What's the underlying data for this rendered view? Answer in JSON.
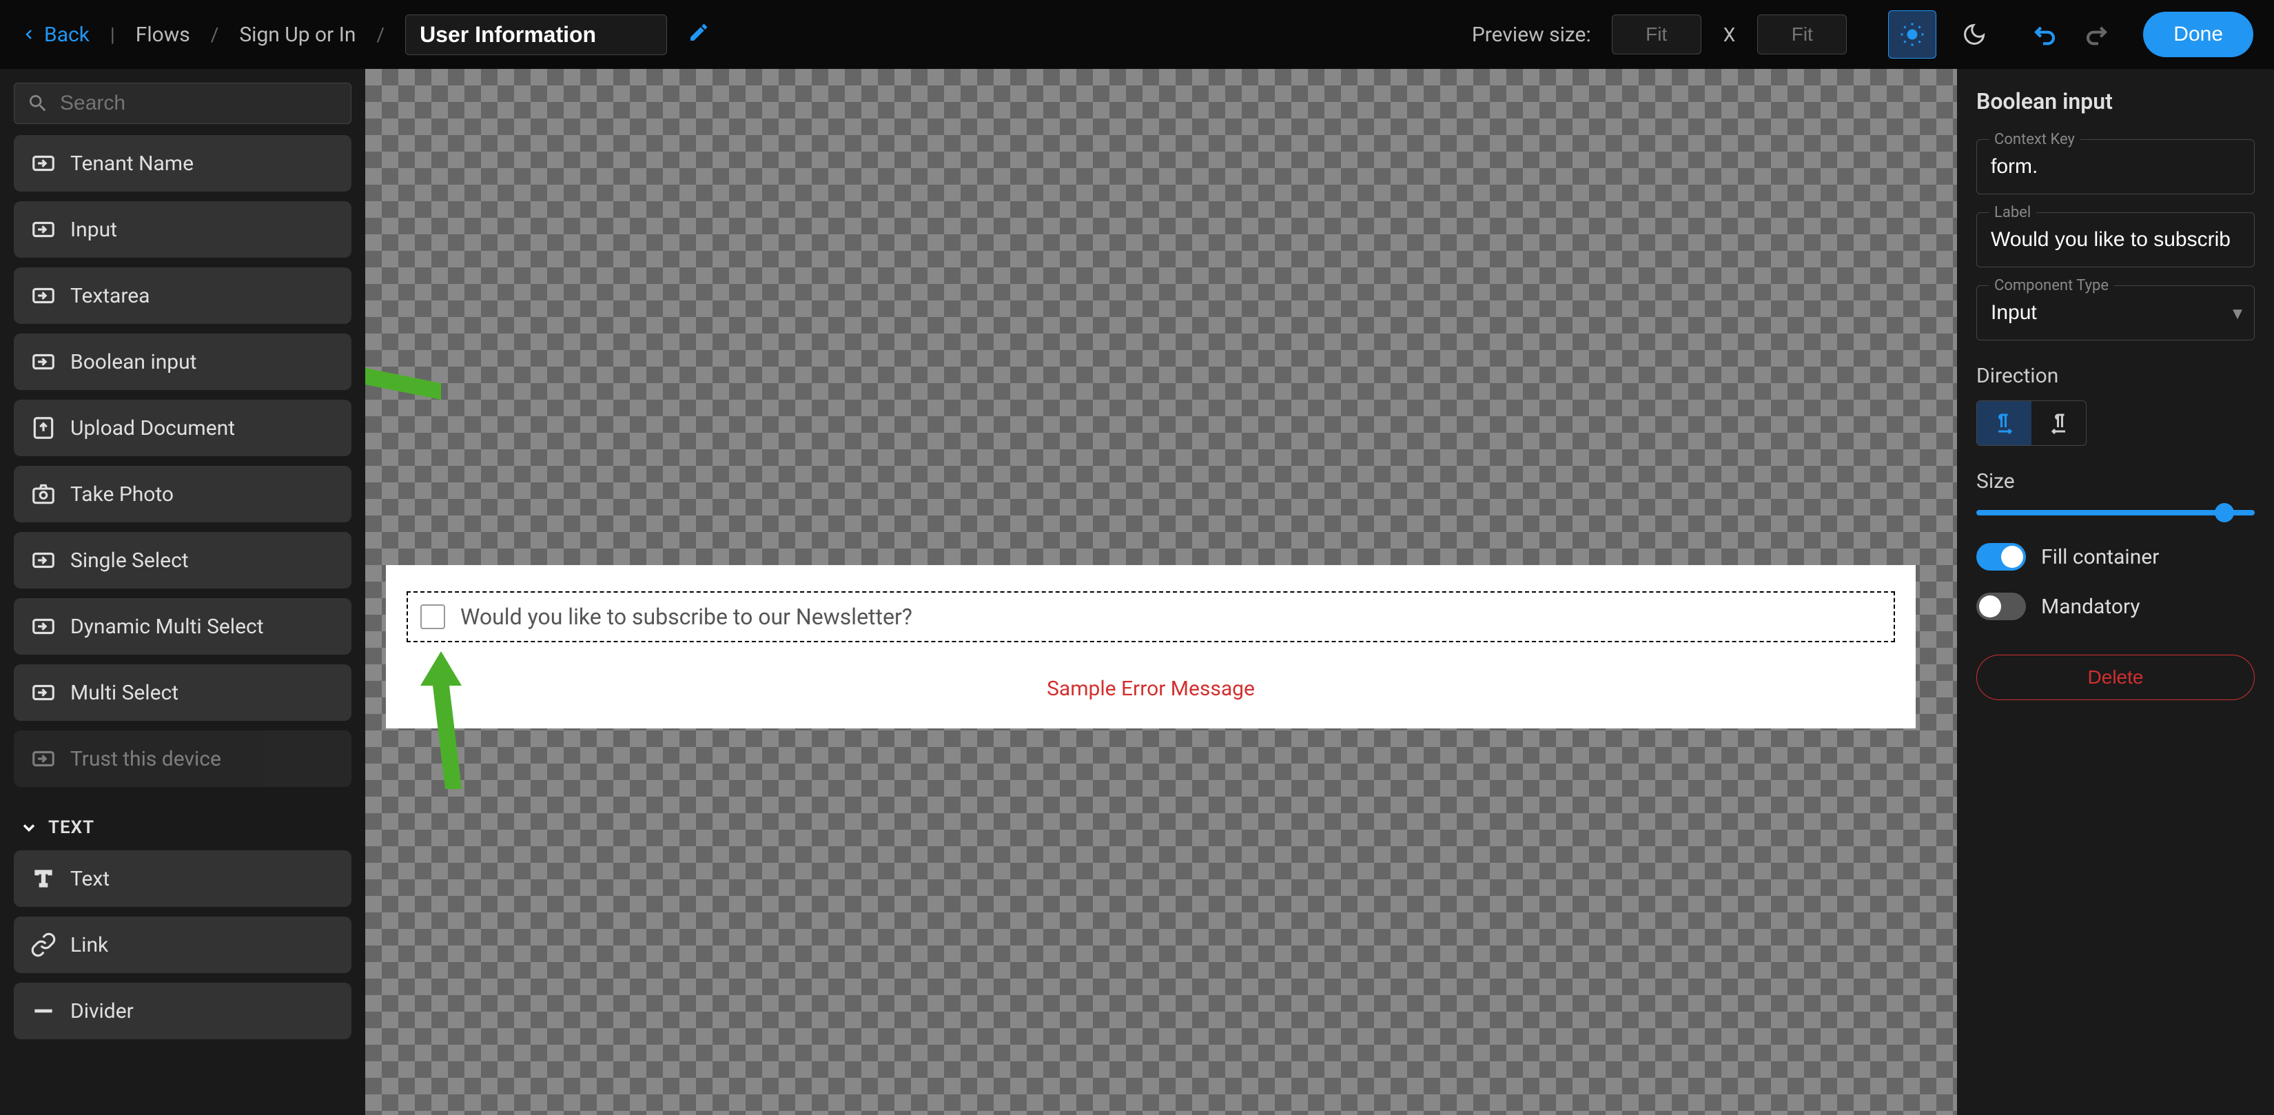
{
  "header": {
    "back_label": "Back",
    "breadcrumb": [
      "Flows",
      "Sign Up or In"
    ],
    "title": "User Information",
    "preview_size_label": "Preview size:",
    "preview_w_placeholder": "Fit",
    "preview_h_placeholder": "Fit",
    "size_x": "X",
    "done_label": "Done"
  },
  "sidebar": {
    "search_placeholder": "Search",
    "components": [
      "Tenant Name",
      "Input",
      "Textarea",
      "Boolean input",
      "Upload Document",
      "Take Photo",
      "Single Select",
      "Dynamic Multi Select",
      "Multi Select",
      "Trust this device"
    ],
    "section_text": "TEXT",
    "text_components": [
      "Text",
      "Link",
      "Divider"
    ]
  },
  "canvas": {
    "question_text": "Would you like to subscribe to our Newsletter?",
    "error_message": "Sample Error Message"
  },
  "props": {
    "title": "Boolean input",
    "context_key_label": "Context Key",
    "context_key_value": "form.",
    "label_label": "Label",
    "label_value": "Would you like to subscrib",
    "component_type_label": "Component Type",
    "component_type_value": "Input",
    "direction_label": "Direction",
    "size_label": "Size",
    "fill_container_label": "Fill container",
    "mandatory_label": "Mandatory",
    "delete_label": "Delete"
  }
}
